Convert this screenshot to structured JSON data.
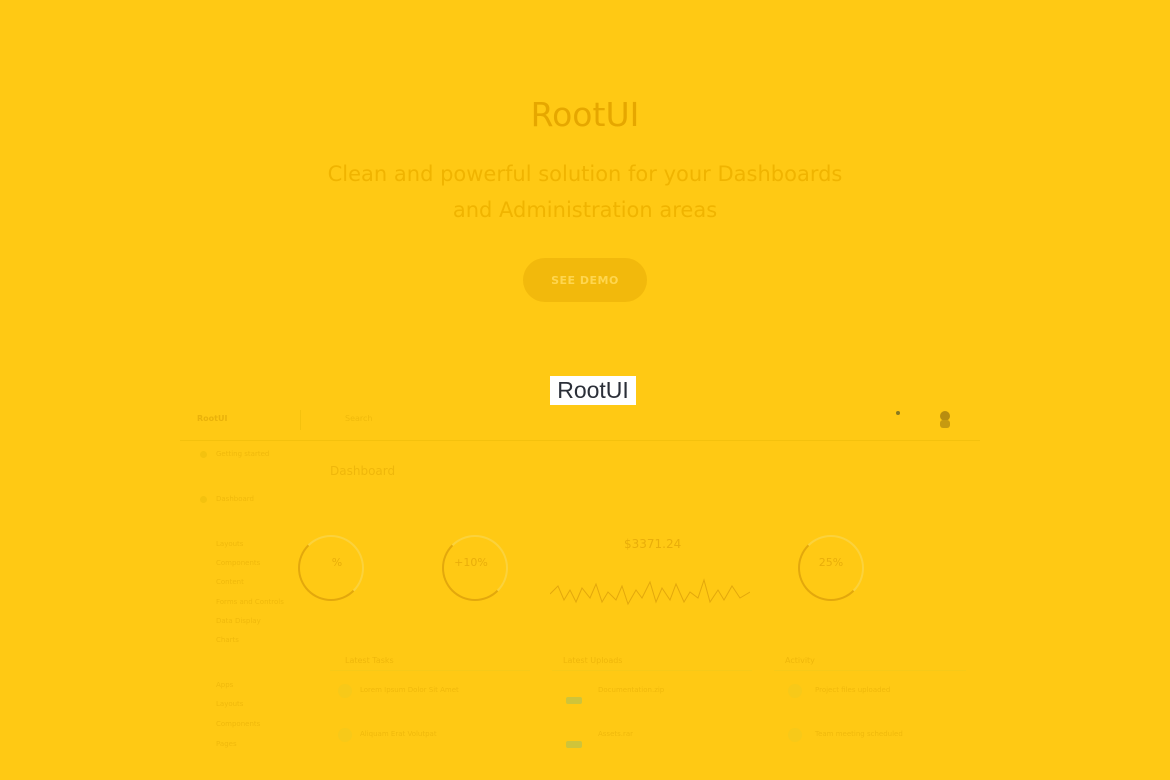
{
  "hero": {
    "title": "RootUI",
    "subtitle_line1": "Clean and powerful solution for your Dashboards",
    "subtitle_line2": "and Administration areas",
    "button_label": "SEE DEMO"
  },
  "mark_label": "RootUI",
  "preview": {
    "brand": "RootUI",
    "search_placeholder": "Search",
    "heading": "Dashboard",
    "sidebar": {
      "items": [
        {
          "label": "Getting started"
        },
        {
          "label": "Dashboard"
        },
        {
          "label": "Layouts"
        },
        {
          "label": "Components"
        },
        {
          "label": "Content"
        },
        {
          "label": "Forms and Controls"
        },
        {
          "label": "Data Display"
        },
        {
          "label": "Charts"
        },
        {
          "label": "Apps"
        },
        {
          "label": "Layouts"
        },
        {
          "label": "Components"
        },
        {
          "label": "Pages"
        }
      ]
    },
    "stats": {
      "ring1": "%",
      "ring2": "+10%",
      "money": "$3371.24",
      "ring3": "25%"
    },
    "cards": [
      {
        "title": "Latest Tasks",
        "rows": [
          {
            "text": "Lorem Ipsum Dolor Sit Amet",
            "sub": ""
          },
          {
            "text": "Aliquam Erat Volutpat",
            "sub": ""
          }
        ]
      },
      {
        "title": "Latest Uploads",
        "rows": [
          {
            "text": "Documentation.zip",
            "sub": ""
          },
          {
            "text": "Assets.rar",
            "sub": ""
          }
        ]
      },
      {
        "title": "Activity",
        "rows": [
          {
            "text": "Project files uploaded",
            "sub": ""
          },
          {
            "text": "Team meeting scheduled",
            "sub": ""
          }
        ]
      }
    ]
  },
  "colors": {
    "background": "#ffc914",
    "title": "#e6a700",
    "button": "#f2b90c"
  }
}
